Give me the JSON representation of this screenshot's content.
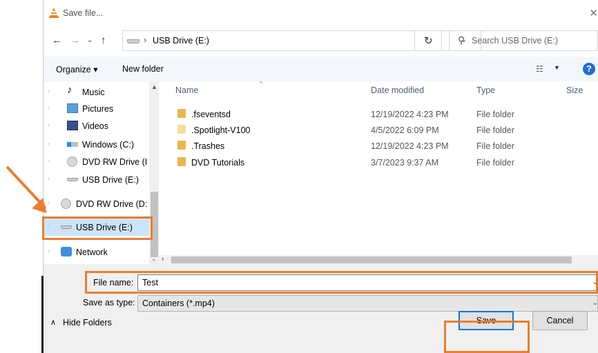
{
  "window": {
    "title": "Save file..."
  },
  "nav": {
    "breadcrumb": "USB Drive (E:)",
    "search_placeholder": "Search USB Drive (E:)"
  },
  "toolbar": {
    "organize": "Organize ▾",
    "new_folder": "New folder"
  },
  "sidebar": {
    "items": [
      {
        "label": "Music"
      },
      {
        "label": "Pictures"
      },
      {
        "label": "Videos"
      },
      {
        "label": "Windows (C:)"
      },
      {
        "label": "DVD RW Drive (I"
      },
      {
        "label": "USB Drive (E:)"
      },
      {
        "label": "DVD RW Drive (D:"
      },
      {
        "label": "USB Drive (E:)"
      },
      {
        "label": "Network"
      }
    ]
  },
  "files": {
    "headers": {
      "name": "Name",
      "date": "Date modified",
      "type": "Type",
      "size": "Size"
    },
    "rows": [
      {
        "name": ".fseventsd",
        "date": "12/19/2022 4:23 PM",
        "type": "File folder"
      },
      {
        "name": ".Spotlight-V100",
        "date": "4/5/2022 6:09 PM",
        "type": "File folder"
      },
      {
        "name": ".Trashes",
        "date": "12/19/2022 4:23 PM",
        "type": "File folder"
      },
      {
        "name": "DVD Tutorials",
        "date": "3/7/2023 9:37 AM",
        "type": "File folder"
      }
    ]
  },
  "form": {
    "filename_label": "File name:",
    "filename_value": "Test",
    "savetype_label": "Save as type:",
    "savetype_value": "Containers (*.mp4)"
  },
  "footer": {
    "hide_folders": "Hide Folders",
    "save": "Save",
    "cancel": "Cancel"
  },
  "colors": {
    "annotation": "#ec7d31",
    "selection": "#cce4f7",
    "accent": "#0078d7"
  }
}
